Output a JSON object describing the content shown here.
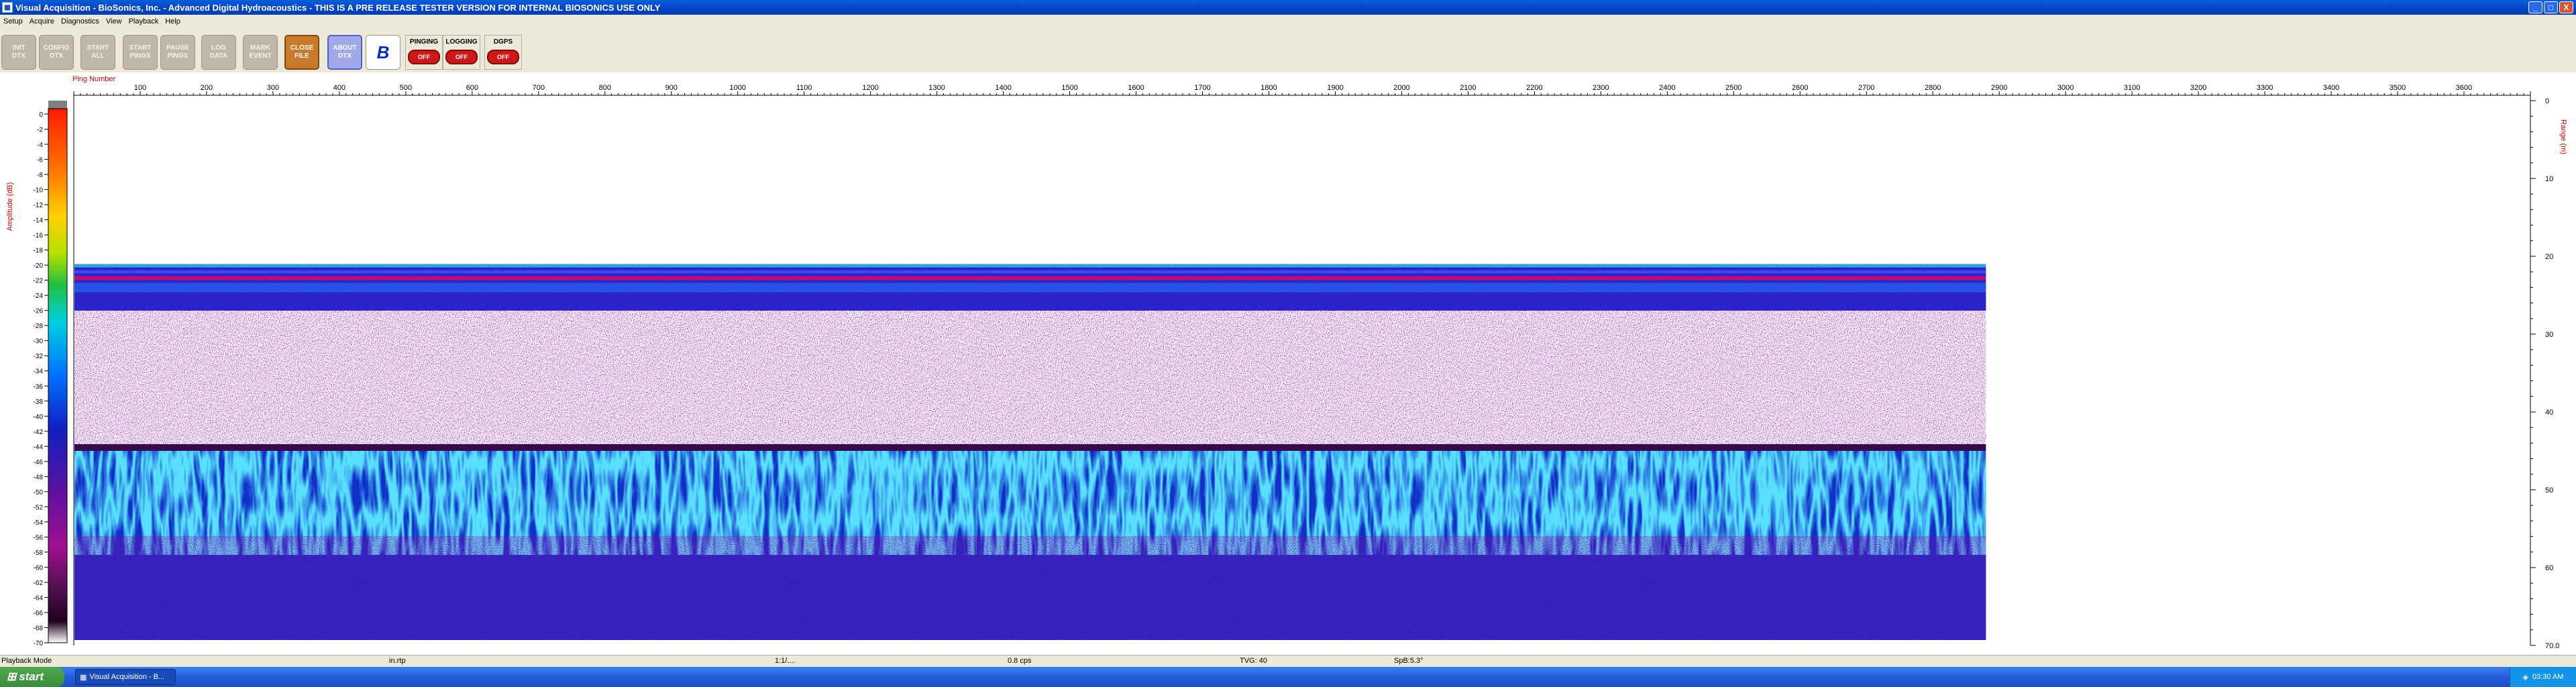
{
  "window": {
    "title": "Visual Acquisition  -  BioSonics, Inc.  -  Advanced Digital Hydroacoustics  -  THIS IS A PRE RELEASE TESTER VERSION FOR INTERNAL BIOSONICS USE ONLY",
    "minimize": "_",
    "maximize": "□",
    "close": "X"
  },
  "menu": [
    "Setup",
    "Acquire",
    "Diagnostics",
    "View",
    "Playback",
    "Help"
  ],
  "toolbar": {
    "buttons": [
      {
        "label": "INIT\nDTX"
      },
      {
        "label": "CONFIG\nDTX"
      },
      {
        "label": "START\nALL"
      },
      {
        "label": "START\nPINGS"
      },
      {
        "label": "PAUSE\nPINGS"
      },
      {
        "label": "LOG\nDATA"
      },
      {
        "label": "MARK\nEVENT"
      },
      {
        "label": "CLOSE\nFILE"
      },
      {
        "label": "ABOUT\nDTX"
      }
    ],
    "toggles": [
      {
        "label": "PINGING",
        "state": "OFF"
      },
      {
        "label": "LOGGING",
        "state": "OFF"
      },
      {
        "label": "DGPS",
        "state": "OFF"
      }
    ]
  },
  "plot": {
    "x_title": "Ping Number",
    "x_ticks": [
      "100",
      "200",
      "300",
      "400",
      "500",
      "600",
      "700",
      "800",
      "900",
      "1000",
      "1100",
      "1200",
      "1300",
      "1400",
      "1500",
      "1600",
      "1700",
      "1800",
      "1900",
      "2000",
      "2100",
      "2200",
      "2300",
      "2400",
      "2500",
      "2600",
      "2700",
      "2800",
      "2900",
      "3000",
      "3100",
      "3200",
      "3300",
      "3400",
      "3500",
      "3600"
    ],
    "amp_title": "Amplitude (dB)",
    "amp_ticks": [
      "0",
      "-2",
      "-4",
      "-6",
      "-8",
      "-10",
      "-12",
      "-14",
      "-16",
      "-18",
      "-20",
      "-22",
      "-24",
      "-26",
      "-28",
      "-30",
      "-32",
      "-34",
      "-36",
      "-38",
      "-40",
      "-42",
      "-44",
      "-46",
      "-48",
      "-50",
      "-52",
      "-54",
      "-56",
      "-58",
      "-60",
      "-62",
      "-64",
      "-66",
      "-68",
      "-70"
    ],
    "range_title": "Range (m)",
    "range_ticks": [
      "0",
      "10",
      "20",
      "30",
      "40",
      "50",
      "60",
      "70.0"
    ],
    "x_max": 3700,
    "data_end_ping": 2880,
    "range_max": 70,
    "surface_band_m": [
      21,
      27
    ],
    "noise_band_m": [
      27,
      45
    ],
    "blue_band_m": [
      45,
      70
    ]
  },
  "status": {
    "mode": "Playback Mode",
    "file": "in.rtp",
    "ratio": "1:1/....",
    "rate": "0.8 cps",
    "tvg": "TVG: 40",
    "spb": "SpB:5.3°"
  },
  "taskbar": {
    "start": "start",
    "task": "Visual Acquisition  -  B...",
    "clock": "03:30 AM"
  }
}
